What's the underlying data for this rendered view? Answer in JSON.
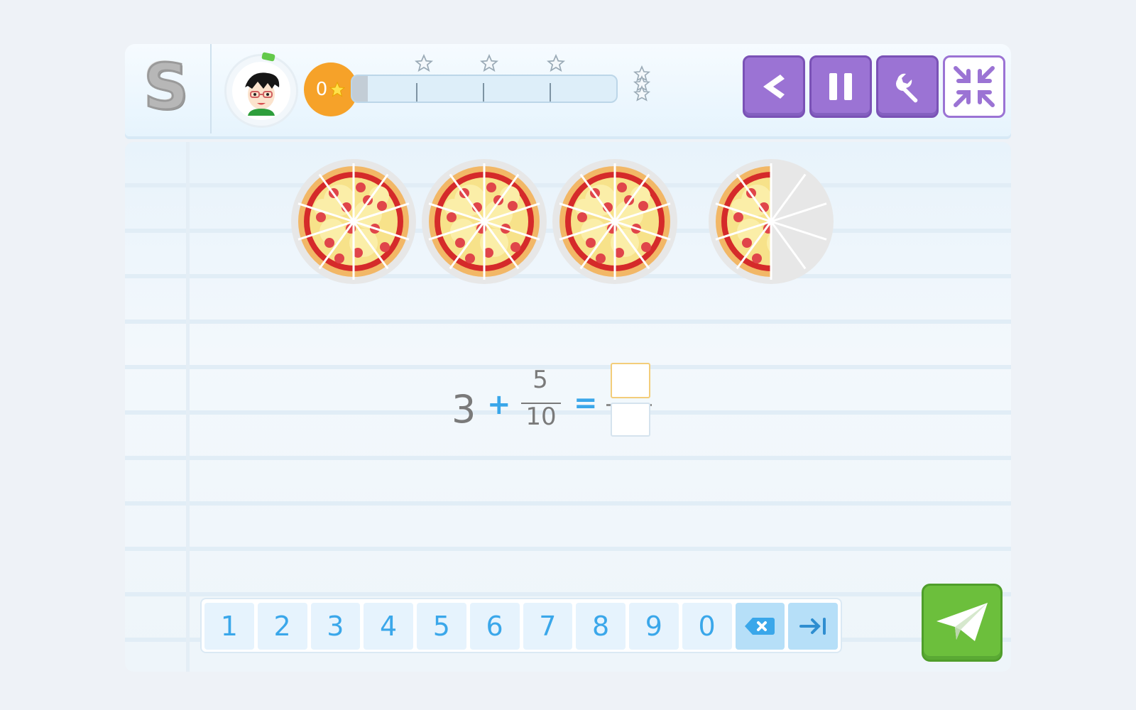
{
  "header": {
    "logo_text": "S",
    "score": {
      "value": "0",
      "icon": "star-icon"
    },
    "progress": {
      "fraction": 0.06,
      "milestones": 3
    }
  },
  "toolbar": {
    "back_icon": "chevron-left-icon",
    "pause_icon": "pause-icon",
    "settings_icon": "wrench-icon",
    "shrink_icon": "exit-fullscreen-icon"
  },
  "problem": {
    "pizzas": [
      {
        "slices_total": 10,
        "slices_present": 10
      },
      {
        "slices_total": 10,
        "slices_present": 10
      },
      {
        "slices_total": 10,
        "slices_present": 10
      },
      {
        "slices_total": 10,
        "slices_present": 5
      }
    ],
    "equation": {
      "whole": "3",
      "plus": "+",
      "numerator": "5",
      "denominator": "10",
      "equals": "="
    },
    "answer": {
      "numerator": "",
      "denominator": ""
    }
  },
  "keypad": {
    "keys": [
      "1",
      "2",
      "3",
      "4",
      "5",
      "6",
      "7",
      "8",
      "9",
      "0"
    ],
    "backspace_icon": "backspace-icon",
    "tab_icon": "tab-next-icon"
  },
  "send_icon": "paper-plane-icon",
  "colors": {
    "accent_purple": "#9b73d4",
    "accent_blue": "#3aa7ea",
    "score_orange": "#f6a229",
    "send_green": "#6cbf3c"
  }
}
